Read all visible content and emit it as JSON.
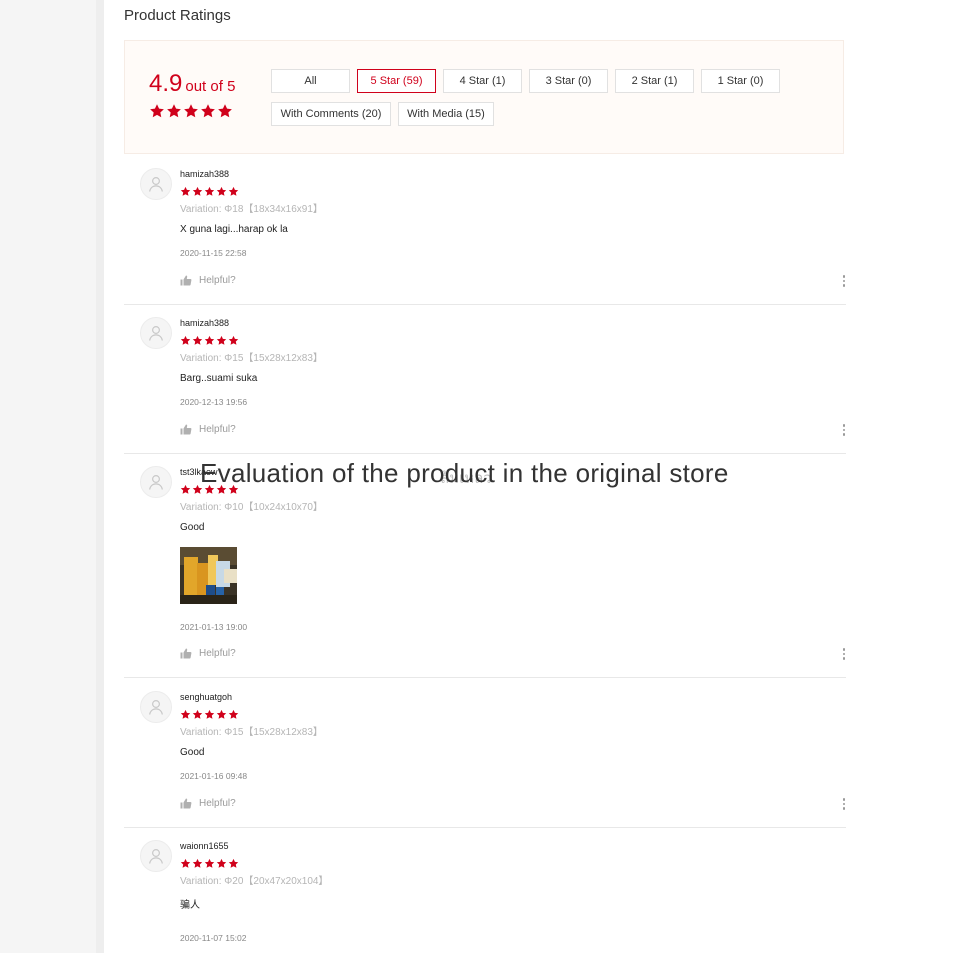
{
  "ratings": {
    "title": "Product Ratings",
    "score": "4.9",
    "score_suffix": "out of 5",
    "accent_color": "#d0011b",
    "star_count": 5,
    "filters": [
      {
        "label": "All",
        "active": false
      },
      {
        "label": "5 Star (59)",
        "active": true
      },
      {
        "label": "4 Star (1)",
        "active": false
      },
      {
        "label": "3 Star (0)",
        "active": false
      },
      {
        "label": "2 Star (1)",
        "active": false
      },
      {
        "label": "1 Star (0)",
        "active": false
      },
      {
        "label": "With Comments (20)",
        "active": false
      },
      {
        "label": "With Media (15)",
        "active": false
      }
    ]
  },
  "reviews": [
    {
      "username": "hamizah388",
      "stars": 5,
      "variation": "Variation: Φ18【18x34x16x91】",
      "comment": "X guna lagi...harap ok la",
      "date": "2020-11-15 22:58",
      "helpful": "Helpful?"
    },
    {
      "username": "hamizah388",
      "stars": 5,
      "variation": "Variation: Φ15【15x28x12x83】",
      "comment": "Barg..suami suka",
      "date": "2020-12-13 19:56",
      "helpful": "Helpful?"
    },
    {
      "username": "tst3lkaew",
      "stars": 5,
      "variation": "Variation: Φ10【10x24x10x70】",
      "comment": "Good",
      "date": "2021-01-13 19:00",
      "helpful": "Helpful?",
      "has_media": true
    },
    {
      "username": "senghuatgoh",
      "stars": 5,
      "variation": "Variation: Φ15【15x28x12x83】",
      "comment": "Good",
      "date": "2021-01-16 09:48",
      "helpful": "Helpful?"
    },
    {
      "username": "waionn1655",
      "stars": 5,
      "variation": "Variation: Φ20【20x47x20x104】",
      "comment": "骗人",
      "date": "2020-11-07 15:02"
    }
  ],
  "overlay": {
    "caption": "Evaluation of the product in the original store",
    "ghost": "ล้มเหลว"
  },
  "icons": {
    "star": "star-icon",
    "avatar": "user-avatar-icon",
    "helpful": "thumbs-up-icon",
    "more": "more-vertical-icon"
  }
}
